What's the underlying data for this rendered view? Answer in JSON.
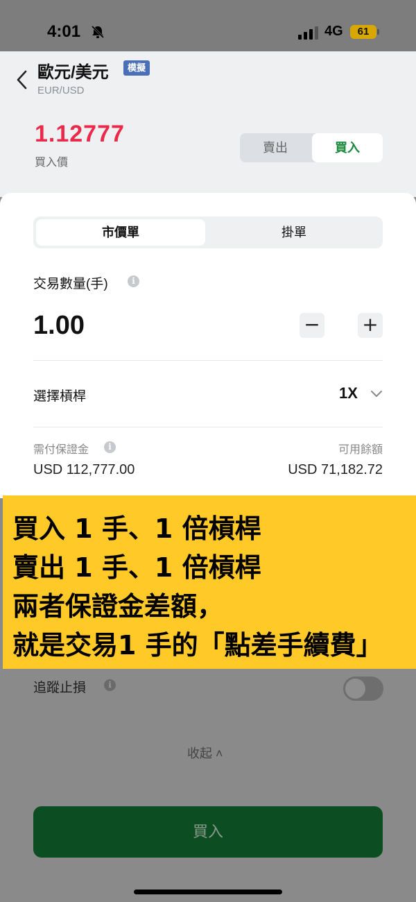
{
  "status_bar": {
    "time": "4:01",
    "network": "4G",
    "battery": "61"
  },
  "header": {
    "pair_name": "歐元/美元",
    "demo_badge": "模擬",
    "pair_code": "EUR/USD",
    "price": "1.12777",
    "price_label": "買入價",
    "sell_label": "賣出",
    "buy_label": "買入"
  },
  "order": {
    "tab_market": "市價單",
    "tab_limit": "掛單",
    "qty_label": "交易數量(手)",
    "qty_value": "1.00",
    "minus": "−",
    "plus": "+",
    "leverage_label": "選擇槓桿",
    "leverage_value": "1X",
    "margin_label": "需付保證金",
    "margin_value": "USD 112,777.00",
    "available_label": "可用餘額",
    "available_value": "USD 71,182.72",
    "info_glyph": "i"
  },
  "banner": {
    "lines": [
      "買入 1 手、1 倍槓桿",
      "賣出 1 手、1 倍槓桿",
      "兩者保證金差額，",
      "就是交易1 手的「點差手續費」"
    ]
  },
  "lower": {
    "trailing_stop_label": "追蹤止損",
    "collapse_label": "收起 ˄",
    "buy_button": "買入"
  },
  "colors": {
    "price": "#ea2a4a",
    "buy": "#1a8a3a",
    "badge": "#4a6fb8",
    "banner": "#ffc928",
    "buy_button": "#0d4d22"
  }
}
